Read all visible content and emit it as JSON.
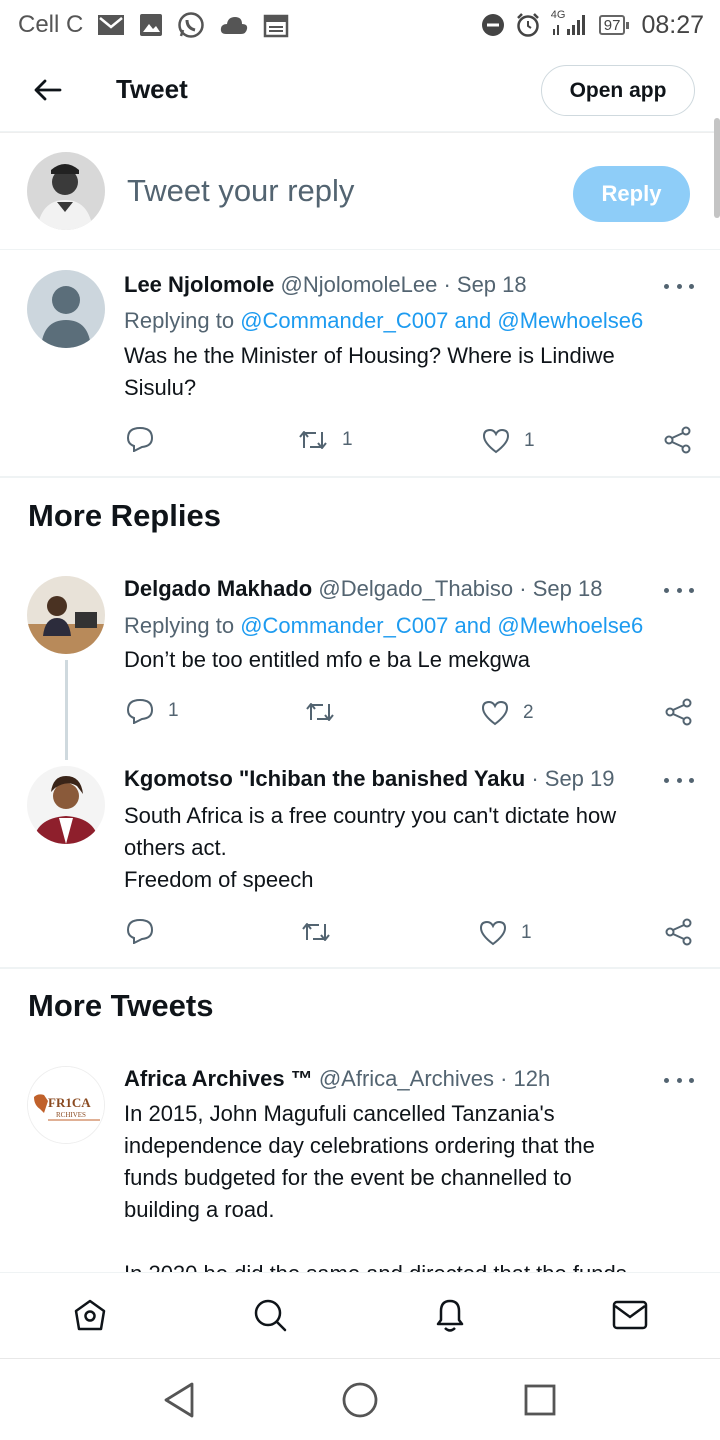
{
  "status_bar": {
    "carrier": "Cell C",
    "network": "4G",
    "battery": "97",
    "time": "08:27"
  },
  "header": {
    "title": "Tweet",
    "open_app_label": "Open app"
  },
  "compose": {
    "placeholder": "Tweet your reply",
    "reply_label": "Reply"
  },
  "tweets": [
    {
      "name": "Lee Njolomole",
      "handle": "@NjolomoleLee · Sep 18",
      "replying_prefix": "Replying to",
      "mention1": "@Commander_C007",
      "joiner": "and",
      "mention2": "@Mewhoelse6",
      "text": "Was he the Minister of Housing? Where is Lindiwe\nSisulu?",
      "replies": "",
      "retweets": "1",
      "likes": "1"
    }
  ],
  "more_replies": {
    "title": "More Replies",
    "items": [
      {
        "name": "Delgado Makhado",
        "handle": "@Delgado_Thabiso · Sep 18",
        "replying_prefix": "Replying to",
        "mention1": "@Commander_C007",
        "joiner": "and",
        "mention2": "@Mewhoelse6",
        "text": "Don’t be too entitled mfo e ba Le mekgwa",
        "replies": "1",
        "retweets": "",
        "likes": "2"
      },
      {
        "name": "Kgomotso \"Ichiban the banished Yaku",
        "handle": "· Sep 19",
        "text": "South Africa is a free country you can't dictate how\nothers act.\nFreedom of speech",
        "replies": "",
        "retweets": "",
        "likes": "1"
      }
    ]
  },
  "more_tweets": {
    "title": "More Tweets",
    "items": [
      {
        "name": "Africa Archives ™",
        "handle": "@Africa_Archives · 12h",
        "avatar_text_top": "FR1CA",
        "avatar_text_bottom": "RCHIVES",
        "text": "In 2015, John Magufuli cancelled Tanzania's\nindependence day celebrations ordering that the\nfunds budgeted for the event be channelled to\nbuilding a road.",
        "truncated_text": "In 2020 he did the same and directed that the funds"
      }
    ]
  },
  "colors": {
    "accent": "#1d9bf0",
    "reply_disabled": "#8ecdf8",
    "secondary_text": "#536471"
  }
}
